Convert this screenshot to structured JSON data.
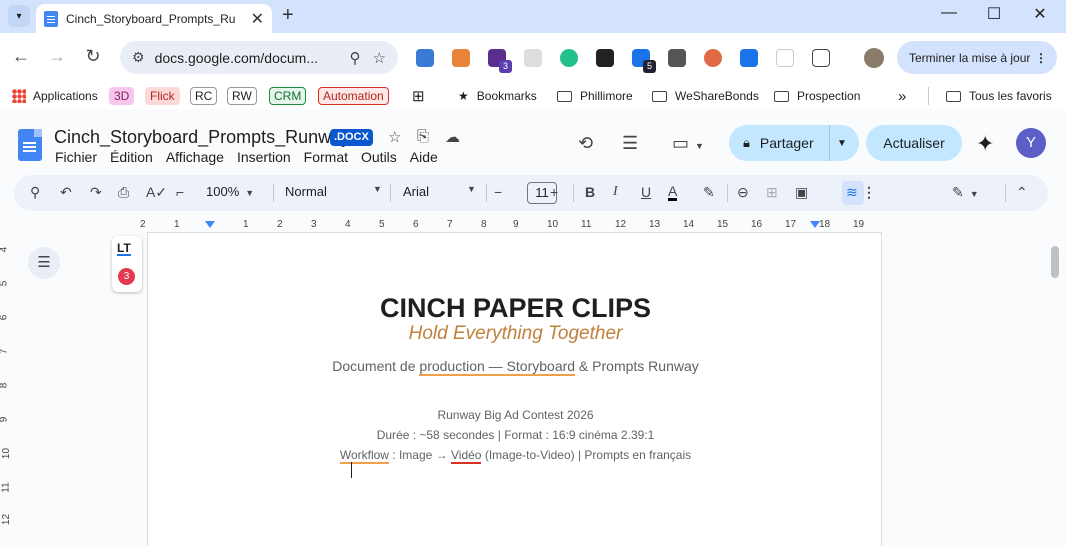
{
  "browser": {
    "tab_title": "Cinch_Storyboard_Prompts_Runway",
    "url": "docs.google.com/docum...",
    "update_button": "Terminer la mise à jour",
    "extension_badges": [
      "3",
      "5"
    ],
    "bookmarks": {
      "apps": "Applications",
      "chips": [
        "3D",
        "Flick",
        "RC",
        "RW",
        "CRM",
        "Automation"
      ],
      "items": [
        "Bookmarks",
        "Phillimore",
        "WeShareBonds",
        "Prospection"
      ],
      "all": "Tous les favoris",
      "more": "»"
    },
    "colors": {
      "tabstrip": "#d3e3fd",
      "omnibox": "#e9eef6"
    }
  },
  "docs": {
    "title": "Cinch_Storyboard_Prompts_Runway",
    "format_badge": ".DOCX",
    "menu": [
      "Fichier",
      "Édition",
      "Affichage",
      "Insertion",
      "Format",
      "Outils",
      "Aide"
    ],
    "share": "Partager",
    "actualiser": "Actualiser",
    "avatar_letter": "Y"
  },
  "toolbar": {
    "zoom": "100%",
    "style": "Normal",
    "font": "Arial",
    "size": "11",
    "bold": "B",
    "italic": "I",
    "underline": "U",
    "text_color": "A"
  },
  "ruler": {
    "h_ticks": [
      "2",
      "1",
      "1",
      "2",
      "3",
      "4",
      "5",
      "6",
      "7",
      "8",
      "9",
      "10",
      "11",
      "12",
      "13",
      "14",
      "15",
      "16",
      "17",
      "18",
      "19"
    ],
    "v_ticks": [
      "4",
      "5",
      "6",
      "7",
      "8",
      "9",
      "10",
      "11",
      "12"
    ]
  },
  "languagetool": {
    "logo": "LT",
    "count": "3"
  },
  "document": {
    "heading": "CINCH PAPER CLIPS",
    "tagline": "Hold Everything Together",
    "subtitle_pre": "Document de ",
    "subtitle_ul": "production — Storyboard",
    "subtitle_post": " & Prompts Runway",
    "contest": "Runway Big Ad Contest 2026",
    "duration": "Durée : ~58 secondes | Format : 16:9 cinéma 2.39:1",
    "workflow_ul": "Workflow",
    "workflow_mid": " : Image → ",
    "workflow_video": "Vidéo",
    "workflow_post": " (Image-to-Video) | Prompts en français"
  }
}
